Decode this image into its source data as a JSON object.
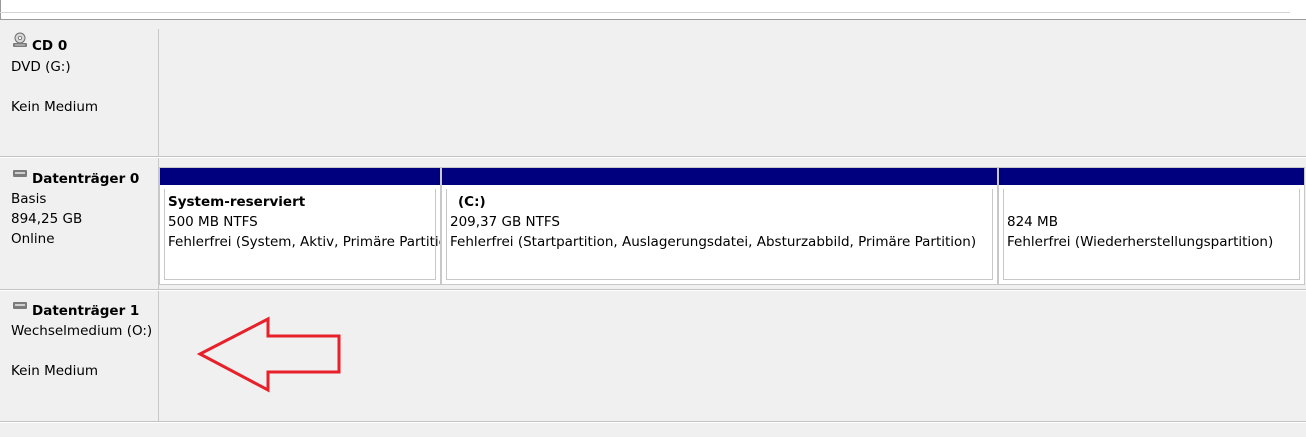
{
  "disks": {
    "cd0": {
      "name": "CD 0",
      "type": "DVD (G:)",
      "status": "Kein Medium",
      "icon": "cd-drive-icon"
    },
    "disk0": {
      "name": "Datenträger 0",
      "type": "Basis",
      "size": "894,25 GB",
      "status": "Online",
      "icon": "hard-disk-icon",
      "partitions": [
        {
          "name": "System-reserviert",
          "size": "500 MB NTFS",
          "status": "Fehlerfrei (System, Aktiv, Primäre Partitic"
        },
        {
          "name": "(C:)",
          "size": "209,37 GB NTFS",
          "status": "Fehlerfrei (Startpartition, Auslagerungsdatei, Absturzabbild, Primäre Partition)"
        },
        {
          "name": "",
          "size": "824 MB",
          "status": "Fehlerfrei (Wiederherstellungspartition)"
        }
      ]
    },
    "disk1": {
      "name": "Datenträger 1",
      "type": "Wechselmedium (O:)",
      "status": "Kein Medium",
      "icon": "hard-disk-icon"
    }
  },
  "colors": {
    "partition_header": "#00007f",
    "annotation_arrow": "#e8202a",
    "background": "#f0f0f0"
  },
  "annotation": {
    "icon": "red-arrow-left-icon"
  }
}
